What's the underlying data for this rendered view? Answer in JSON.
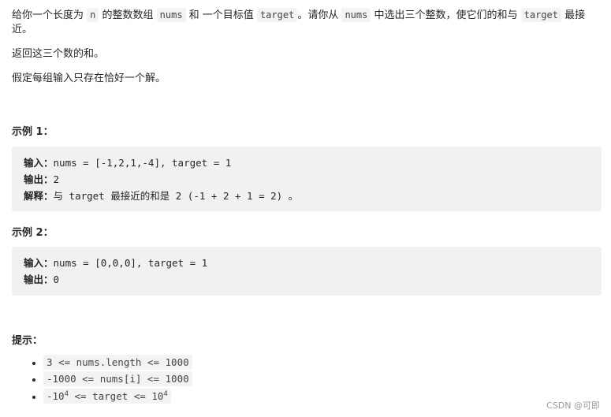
{
  "description": {
    "p1": [
      "给你一个长度为 ",
      "n",
      " 的整数数组 ",
      "nums",
      " 和 一个目标值 ",
      "target",
      "。请你从 ",
      "nums",
      " 中选出三个整数，使它们的和与 ",
      "target",
      " 最接近。"
    ],
    "p2": "返回这三个数的和。",
    "p3": "假定每组输入只存在恰好一个解。"
  },
  "examples": [
    {
      "title": "示例 1：",
      "input_label": "输入：",
      "input": "nums = [-1,2,1,-4], target = 1",
      "output_label": "输出：",
      "output": "2",
      "explain_label": "解释：",
      "explain": "与 target 最接近的和是 2 (-1 + 2 + 1 = 2) 。"
    },
    {
      "title": "示例 2：",
      "input_label": "输入：",
      "input": "nums = [0,0,0], target = 1",
      "output_label": "输出：",
      "output": "0"
    }
  ],
  "hints": {
    "title": "提示：",
    "items": [
      "3 <= nums.length <= 1000",
      "-1000 <= nums[i] <= 1000"
    ],
    "item3": {
      "a": "-10",
      "exp1": "4",
      "b": " <= target <= 10",
      "exp2": "4"
    }
  },
  "watermark": "CSDN @可即"
}
